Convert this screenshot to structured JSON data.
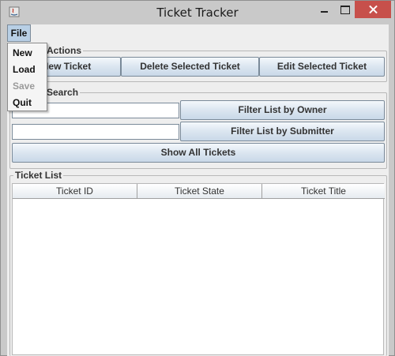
{
  "window": {
    "title": "Ticket Tracker"
  },
  "menubar": {
    "file_label": "File"
  },
  "file_menu": {
    "items": [
      {
        "label": "New",
        "enabled": true
      },
      {
        "label": "Load",
        "enabled": true
      },
      {
        "label": "Save",
        "enabled": false
      },
      {
        "label": "Quit",
        "enabled": true
      }
    ]
  },
  "actions": {
    "title": "Actions",
    "new_ticket": "New Ticket",
    "delete_selected": "Delete Selected Ticket",
    "edit_selected": "Edit Selected Ticket"
  },
  "search": {
    "title": "Search",
    "owner_value": "",
    "submitter_value": "",
    "filter_owner": "Filter List by Owner",
    "filter_submitter": "Filter List by Submitter",
    "show_all": "Show All Tickets"
  },
  "ticket_list": {
    "title": "Ticket List",
    "columns": [
      "Ticket ID",
      "Ticket State",
      "Ticket Title"
    ],
    "rows": []
  },
  "colors": {
    "close_button": "#c7504b",
    "menu_selected": "#b8cfe5"
  }
}
